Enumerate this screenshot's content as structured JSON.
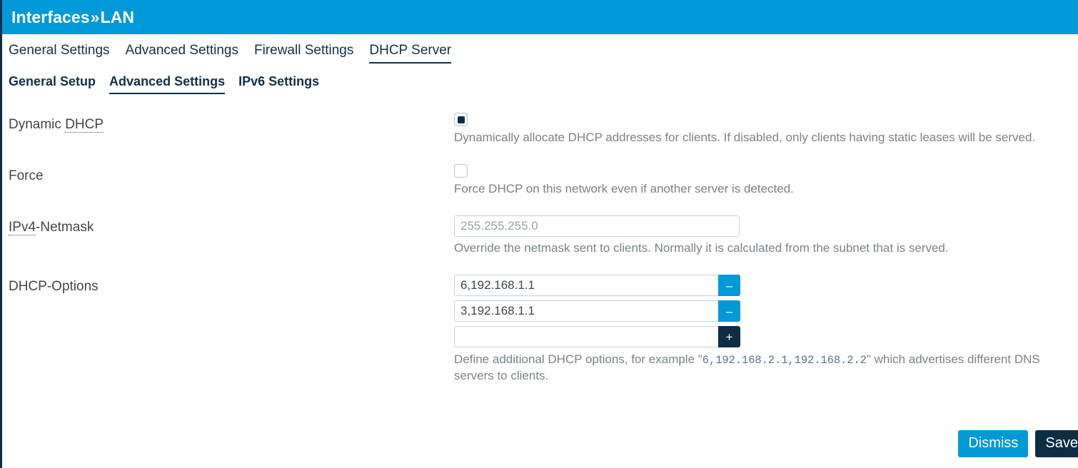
{
  "header": {
    "breadcrumb_parent": "Interfaces",
    "separator": "»",
    "breadcrumb_current": "LAN",
    "accent_color": "#0099d8",
    "dark_color": "#0d2d45"
  },
  "primary_tabs": [
    {
      "label": "General Settings",
      "active": false
    },
    {
      "label": "Advanced Settings",
      "active": false
    },
    {
      "label": "Firewall Settings",
      "active": false
    },
    {
      "label": "DHCP Server",
      "active": true
    }
  ],
  "secondary_tabs": [
    {
      "label": "General Setup",
      "active": false
    },
    {
      "label": "Advanced Settings",
      "active": true
    },
    {
      "label": "IPv6 Settings",
      "active": false
    }
  ],
  "form": {
    "dynamic_dhcp": {
      "label_prefix": "Dynamic ",
      "label_abbr": "DHCP",
      "checked": true,
      "hint": "Dynamically allocate DHCP addresses for clients. If disabled, only clients having static leases will be served."
    },
    "force": {
      "label": "Force",
      "checked": false,
      "hint": "Force DHCP on this network even if another server is detected."
    },
    "netmask": {
      "label_abbr": "IPv4",
      "label_suffix": "-Netmask",
      "value": "",
      "placeholder": "255.255.255.0",
      "hint": "Override the netmask sent to clients. Normally it is calculated from the subnet that is served."
    },
    "dhcp_options": {
      "label": "DHCP-Options",
      "entries": [
        {
          "value": "6,192.168.1.1",
          "button": "–",
          "button_kind": "remove"
        },
        {
          "value": "3,192.168.1.1",
          "button": "–",
          "button_kind": "remove"
        },
        {
          "value": "",
          "button": "+",
          "button_kind": "add"
        }
      ],
      "placeholder": "",
      "hint_before": "Define additional DHCP options, for example \"",
      "hint_code": "6,192.168.2.1,192.168.2.2",
      "hint_after": "\" which advertises different DNS servers to clients."
    }
  },
  "actions": {
    "dismiss_label": "Dismiss",
    "save_label": "Save"
  }
}
